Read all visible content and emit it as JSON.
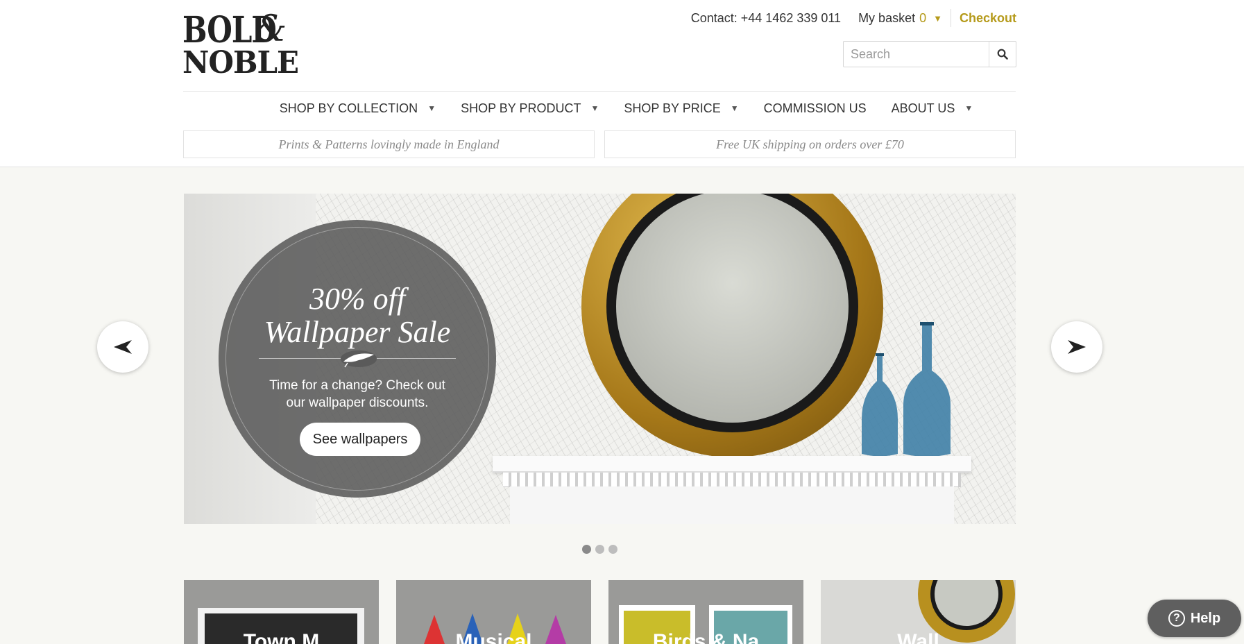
{
  "brand": {
    "logo_line1": "BOLD",
    "logo_amp": "&",
    "logo_line2": "NOBLE"
  },
  "topbar": {
    "contact": "Contact: +44 1462 339 011",
    "basket_label": "My basket",
    "basket_count": "0",
    "checkout": "Checkout"
  },
  "search": {
    "placeholder": "Search",
    "icon": "search-icon"
  },
  "nav": {
    "items": [
      {
        "label": "SHOP BY COLLECTION",
        "has_dropdown": true
      },
      {
        "label": "SHOP BY PRODUCT",
        "has_dropdown": true
      },
      {
        "label": "SHOP BY PRICE",
        "has_dropdown": true
      },
      {
        "label": "COMMISSION US",
        "has_dropdown": false
      },
      {
        "label": "ABOUT US",
        "has_dropdown": true
      }
    ]
  },
  "promos": {
    "left": "Prints & Patterns lovingly made in England",
    "right": "Free UK shipping on orders over £70"
  },
  "hero": {
    "title_line1": "30% off",
    "title_line2": "Wallpaper Sale",
    "subtitle": "Time for a change? Check out our wallpaper discounts.",
    "cta": "See wallpapers",
    "slide_count": 3,
    "active_slide": 1
  },
  "tiles": [
    {
      "caption": "Town M"
    },
    {
      "caption": "Musical"
    },
    {
      "caption": "Birds & Na"
    },
    {
      "caption": "Wall"
    }
  ],
  "help": {
    "label": "Help"
  },
  "colors": {
    "accent": "#b59a1a",
    "page_bg": "#f7f7f3",
    "help_bg": "#5f5f5f"
  }
}
